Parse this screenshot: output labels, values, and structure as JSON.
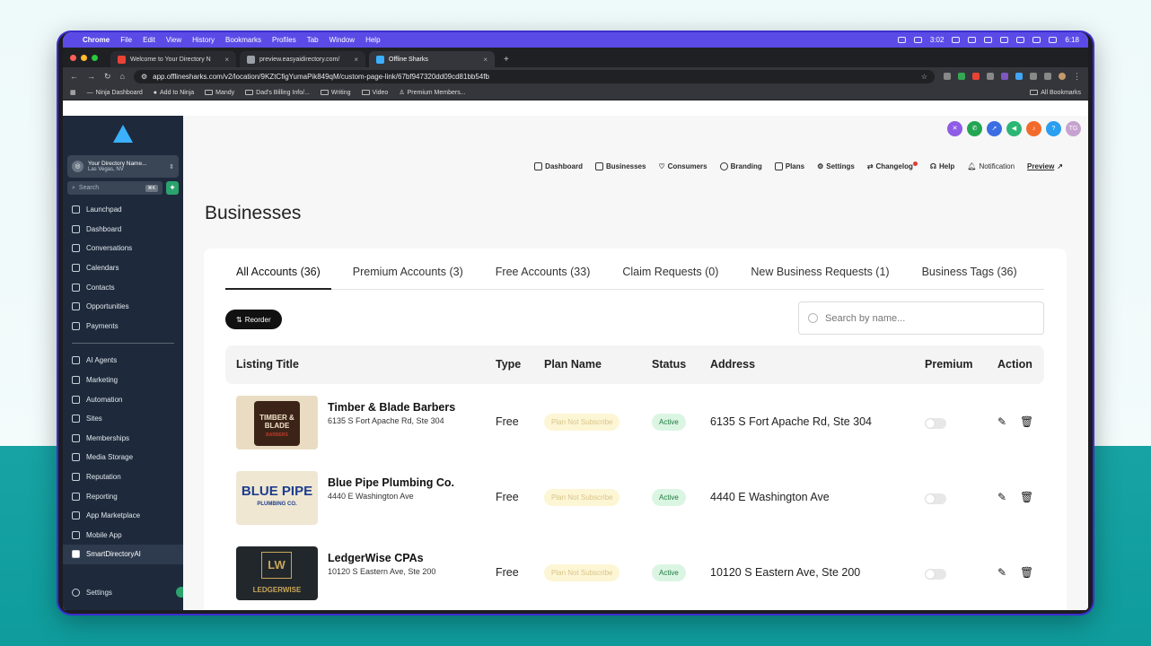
{
  "menubar": {
    "app": "Chrome",
    "items": [
      "File",
      "Edit",
      "View",
      "History",
      "Bookmarks",
      "Profiles",
      "Tab",
      "Window",
      "Help"
    ],
    "timer": "3:02",
    "clock": "6:18"
  },
  "browser": {
    "tabs": [
      {
        "label": "Welcome to Your Directory N"
      },
      {
        "label": "preview.easyaidirectory.com/"
      },
      {
        "label": "Offline Sharks"
      }
    ],
    "url": "app.offlinesharks.com/v2/location/9KZtCfigYumaPik849qM/custom-page-link/67bf947320dd09cd81bb54fb",
    "bookmarks": [
      "Ninja Dashboard",
      "Add to Ninja",
      "Mandy",
      "Dad's Billing Info/...",
      "Writing",
      "Video",
      "Premium Members..."
    ],
    "all_bookmarks": "All Bookmarks"
  },
  "sidebar": {
    "account_name": "Your Directory Name...",
    "account_location": "Las Vegas, NV",
    "search_placeholder": "Search",
    "search_kbd": "⌘K",
    "nav_top": [
      "Launchpad",
      "Dashboard",
      "Conversations",
      "Calendars",
      "Contacts",
      "Opportunities",
      "Payments"
    ],
    "nav_bottom": [
      "AI Agents",
      "Marketing",
      "Automation",
      "Sites",
      "Memberships",
      "Media Storage",
      "Reputation",
      "Reporting",
      "App Marketplace",
      "Mobile App",
      "SmartDirectoryAI"
    ],
    "settings": "Settings"
  },
  "topbar": {
    "avatar_initials": "TG",
    "nav": [
      "Dashboard",
      "Businesses",
      "Consumers",
      "Branding",
      "Plans",
      "Settings",
      "Changelog",
      "Help",
      "Notification"
    ],
    "preview": "Preview"
  },
  "page": {
    "title": "Businesses",
    "tabs": [
      "All Accounts (36)",
      "Premium Accounts (3)",
      "Free Accounts (33)",
      "Claim Requests (0)",
      "New Business Requests (1)",
      "Business Tags (36)"
    ],
    "reorder_label": "Reorder",
    "search_placeholder": "Search by name..."
  },
  "table": {
    "headers": [
      "Listing Title",
      "Type",
      "Plan Name",
      "Status",
      "Address",
      "Premium",
      "Action"
    ],
    "rows": [
      {
        "title": "Timber & Blade Barbers",
        "subtitle": "6135 S Fort Apache Rd, Ste 304",
        "type": "Free",
        "plan": "Plan Not Subscribe",
        "status": "Active",
        "address": "6135 S Fort Apache Rd, Ste 304",
        "premium": false,
        "logo_text": "TIMBER & BLADE",
        "logo_sub": "BARBERS"
      },
      {
        "title": "Blue Pipe Plumbing Co.",
        "subtitle": "4440 E Washington Ave",
        "type": "Free",
        "plan": "Plan Not Subscribe",
        "status": "Active",
        "address": "4440 E Washington Ave",
        "premium": false,
        "logo_text": "BLUE PIPE",
        "logo_sub": "PLUMBING CO."
      },
      {
        "title": "LedgerWise CPAs",
        "subtitle": "10120 S Eastern Ave, Ste 200",
        "type": "Free",
        "plan": "Plan Not Subscribe",
        "status": "Active",
        "address": "10120 S Eastern Ave, Ste 200",
        "premium": false,
        "logo_text": "LW",
        "logo_sub": "LEDGERWISE"
      }
    ]
  },
  "colors": {
    "menubar": "#5b4be6",
    "sidebar": "#1e2a3b",
    "active_badge": "#dbf5e3",
    "plan_badge": "#fdf6d5"
  }
}
